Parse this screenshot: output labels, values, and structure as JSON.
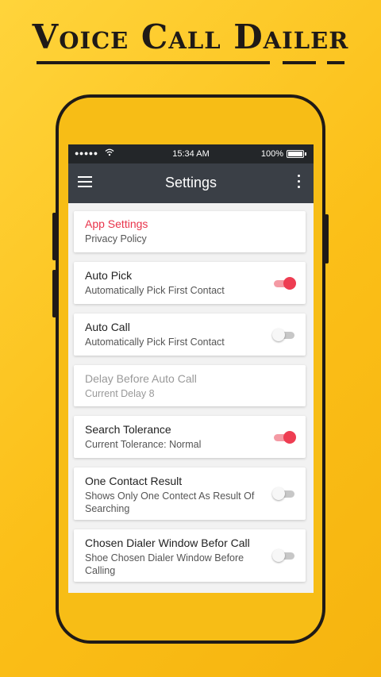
{
  "promo": {
    "title": "Voice Call Dailer"
  },
  "status_bar": {
    "signal": "●●●●●",
    "time": "15:34 AM",
    "battery": "100%"
  },
  "app_bar": {
    "title": "Settings"
  },
  "settings": [
    {
      "title": "App Settings",
      "subtitle": "Privacy Policy",
      "accent": true
    },
    {
      "title": "Auto Pick",
      "subtitle": "Automatically Pick First Contact",
      "toggle": true,
      "on": true
    },
    {
      "title": "Auto Call",
      "subtitle": "Automatically Pick First Contact",
      "toggle": true,
      "on": false
    },
    {
      "title": "Delay Before Auto Call",
      "subtitle": "Current Delay 8",
      "disabled": true
    },
    {
      "title": "Search Tolerance",
      "subtitle": "Current Tolerance: Normal",
      "toggle": true,
      "on": true
    },
    {
      "title": "One Contact Result",
      "subtitle": "Shows Only One Contect As Result Of Searching",
      "toggle": true,
      "on": false
    },
    {
      "title": "Chosen Dialer Window Befor Call",
      "subtitle": "Shoe Chosen Dialer Window Before Calling",
      "toggle": true,
      "on": false
    }
  ],
  "colors": {
    "background": "#fbbf18",
    "accent": "#e8334a",
    "app_bar": "#3a3f46",
    "toggle_on": "#ee3d52"
  }
}
